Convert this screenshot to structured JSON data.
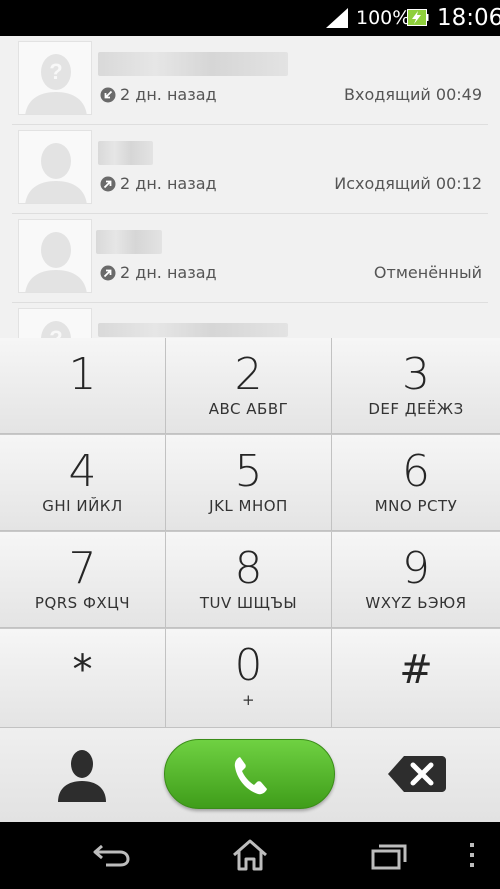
{
  "status_bar": {
    "signal_icon": "signal-icon",
    "battery_percent": "100%",
    "battery_icon": "battery-charging-icon",
    "time": "18:06"
  },
  "call_log": {
    "entries": [
      {
        "avatar": "unknown-contact-avatar",
        "direction_icon": "incoming-call-icon",
        "when": "2 дн. назад",
        "type": "Входящий 00:49"
      },
      {
        "avatar": "contact-avatar",
        "direction_icon": "outgoing-call-icon",
        "when": "2 дн. назад",
        "type": "Исходящий 00:12"
      },
      {
        "avatar": "contact-avatar",
        "direction_icon": "outgoing-call-icon",
        "when": "2 дн. назад",
        "type": "Отменённый"
      }
    ]
  },
  "keypad": {
    "keys": [
      {
        "digit": "1",
        "letters": ""
      },
      {
        "digit": "2",
        "letters": "ABC АБВГ"
      },
      {
        "digit": "3",
        "letters": "DEF ДЕЁЖЗ"
      },
      {
        "digit": "4",
        "letters": "GHI ИЙКЛ"
      },
      {
        "digit": "5",
        "letters": "JKL МНОП"
      },
      {
        "digit": "6",
        "letters": "MNO РСТУ"
      },
      {
        "digit": "7",
        "letters": "PQRS ФХЦЧ"
      },
      {
        "digit": "8",
        "letters": "TUV ШЩЪЫ"
      },
      {
        "digit": "9",
        "letters": "WXYZ ЬЭЮЯ"
      },
      {
        "digit": "*",
        "letters": ""
      },
      {
        "digit": "0",
        "letters": "+"
      },
      {
        "digit": "#",
        "letters": ""
      }
    ]
  },
  "actions": {
    "contacts_icon": "person-icon",
    "call_icon": "phone-icon",
    "backspace_icon": "backspace-icon",
    "call_color": "#4caf2a"
  },
  "nav_bar": {
    "back_icon": "back-icon",
    "home_icon": "home-icon",
    "recent_icon": "recent-apps-icon",
    "menu_icon": "overflow-menu-icon"
  }
}
